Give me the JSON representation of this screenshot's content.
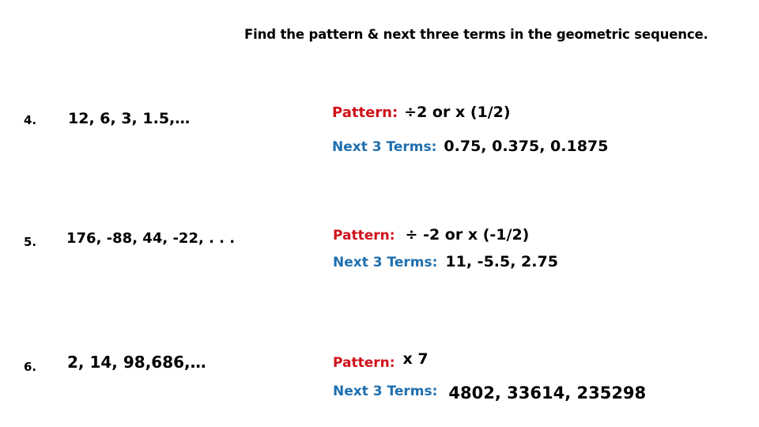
{
  "title": "Find the pattern & next three terms in the geometric sequence.",
  "colors": {
    "pattern_label": "#D0121B",
    "next_terms_label": "#1F6FAF",
    "text": "#000000",
    "background": "#FFFFFF"
  },
  "labels": {
    "pattern": "Pattern:",
    "next_terms": "Next 3 Terms:"
  },
  "problems": [
    {
      "number": "4.",
      "sequence": "12, 6, 3, 1.5,…",
      "pattern_label": "Pattern:",
      "pattern_value": "÷2   or   x (1/2)",
      "next_label": "Next 3 Terms:",
      "next_value": "0.75,  0.375,  0.1875"
    },
    {
      "number": "5.",
      "sequence": "176, -88, 44, -22, . . .",
      "pattern_label": "Pattern:",
      "pattern_value": "÷ -2   or   x (-1/2)",
      "next_label": "Next 3 Terms:",
      "next_value": "11,  -5.5,  2.75"
    },
    {
      "number": "6.",
      "sequence": "2, 14, 98,686,…",
      "pattern_label": "Pattern:",
      "pattern_value": "x 7",
      "next_label": "Next 3 Terms:",
      "next_value": "4802, 33614, 235298"
    }
  ]
}
